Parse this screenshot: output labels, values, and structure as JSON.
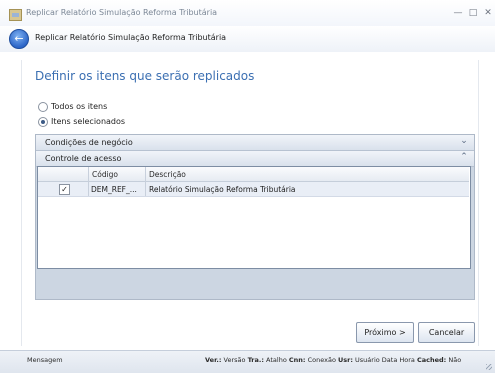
{
  "window": {
    "title": "Replicar Relatório Simulação Reforma Tributária",
    "minimize": "—",
    "maximize": "□",
    "close": "✕"
  },
  "wizard": {
    "back_glyph": "←",
    "title": "Replicar Relatório Simulação Reforma Tributária",
    "heading": "Definir os itens que serão replicados"
  },
  "options": [
    {
      "label": "Todos os itens",
      "selected": false
    },
    {
      "label": "Itens selecionados",
      "selected": true
    }
  ],
  "groups": [
    {
      "label": "Condições de negócio",
      "chevron": "⌄"
    },
    {
      "label": "Controle de acesso",
      "chevron": "⌃"
    }
  ],
  "grid": {
    "columns": [
      "Código",
      "Descrição"
    ],
    "rows": [
      {
        "checked": "✓",
        "codigo": "DEM_REF_...",
        "descricao": "Relatório Simulação Reforma Tributária"
      }
    ]
  },
  "buttons": {
    "next": "Próximo >",
    "cancel": "Cancelar"
  },
  "status": {
    "message": "Mensagem",
    "items": [
      {
        "key": "Ver.:",
        "value": "Versão"
      },
      {
        "key": "Tra.:",
        "value": "Atalho"
      },
      {
        "key": "Cnn:",
        "value": "Conexão"
      },
      {
        "key": "Usr:",
        "value": "Usuário Data Hora"
      },
      {
        "key": "Cached:",
        "value": "Não"
      }
    ]
  }
}
